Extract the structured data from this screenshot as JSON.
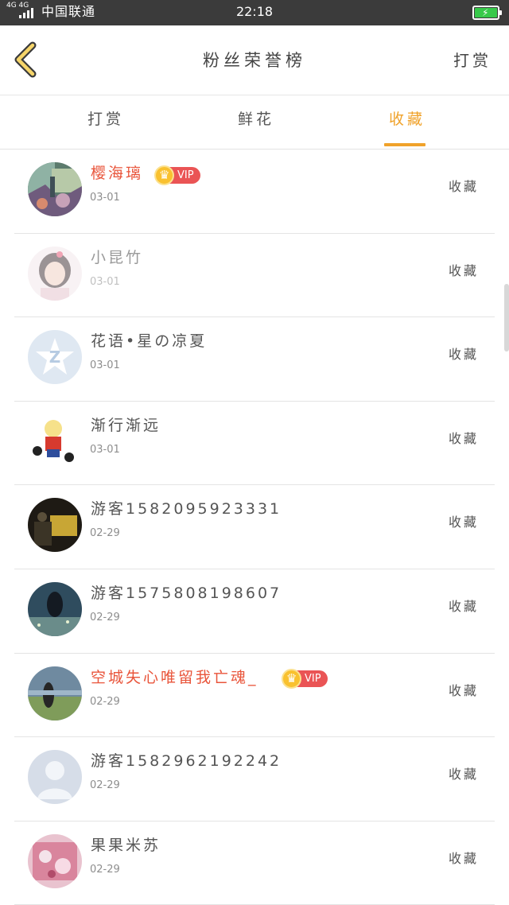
{
  "status_bar": {
    "network": "4G 4G",
    "carrier": "中国联通",
    "time": "22:18",
    "battery_color": "#37c94a"
  },
  "header": {
    "back_icon": "chevron-left-icon",
    "title": "粉丝荣誉榜",
    "action_label": "打赏"
  },
  "tabs": [
    {
      "label": "打赏",
      "active": false
    },
    {
      "label": "鲜花",
      "active": false
    },
    {
      "label": "收藏",
      "active": true
    }
  ],
  "accent_color": "#f0a22a",
  "vip_color": "#e9553b",
  "rows": [
    {
      "name": "樱海璃",
      "date": "03-01",
      "vip": true,
      "vip_label": "VIP",
      "type": "收藏",
      "avatar": "anime-scene-avatar"
    },
    {
      "name": "小昆竹",
      "date": "03-01",
      "vip": false,
      "type": "收藏",
      "avatar": "girl-photo-avatar"
    },
    {
      "name": "花语•星の凉夏",
      "date": "03-01",
      "vip": false,
      "type": "收藏",
      "avatar": "qq-star-default-avatar"
    },
    {
      "name": "渐行渐远",
      "date": "03-01",
      "vip": false,
      "type": "收藏",
      "avatar": "cartoon-character-avatar"
    },
    {
      "name": "游客1582095923331",
      "date": "02-29",
      "vip": false,
      "type": "收藏",
      "avatar": "dark-photo-avatar"
    },
    {
      "name": "游客1575808198607",
      "date": "02-29",
      "vip": false,
      "type": "收藏",
      "avatar": "night-scene-avatar"
    },
    {
      "name": "空城失心唯留我亡魂_",
      "date": "02-29",
      "vip": true,
      "vip_label": "VIP",
      "type": "收藏",
      "avatar": "landscape-girl-avatar"
    },
    {
      "name": "游客1582962192242",
      "date": "02-29",
      "vip": false,
      "type": "收藏",
      "avatar": "default-person-avatar"
    },
    {
      "name": "果果米苏",
      "date": "02-29",
      "vip": false,
      "type": "收藏",
      "avatar": "pink-floral-avatar"
    }
  ]
}
